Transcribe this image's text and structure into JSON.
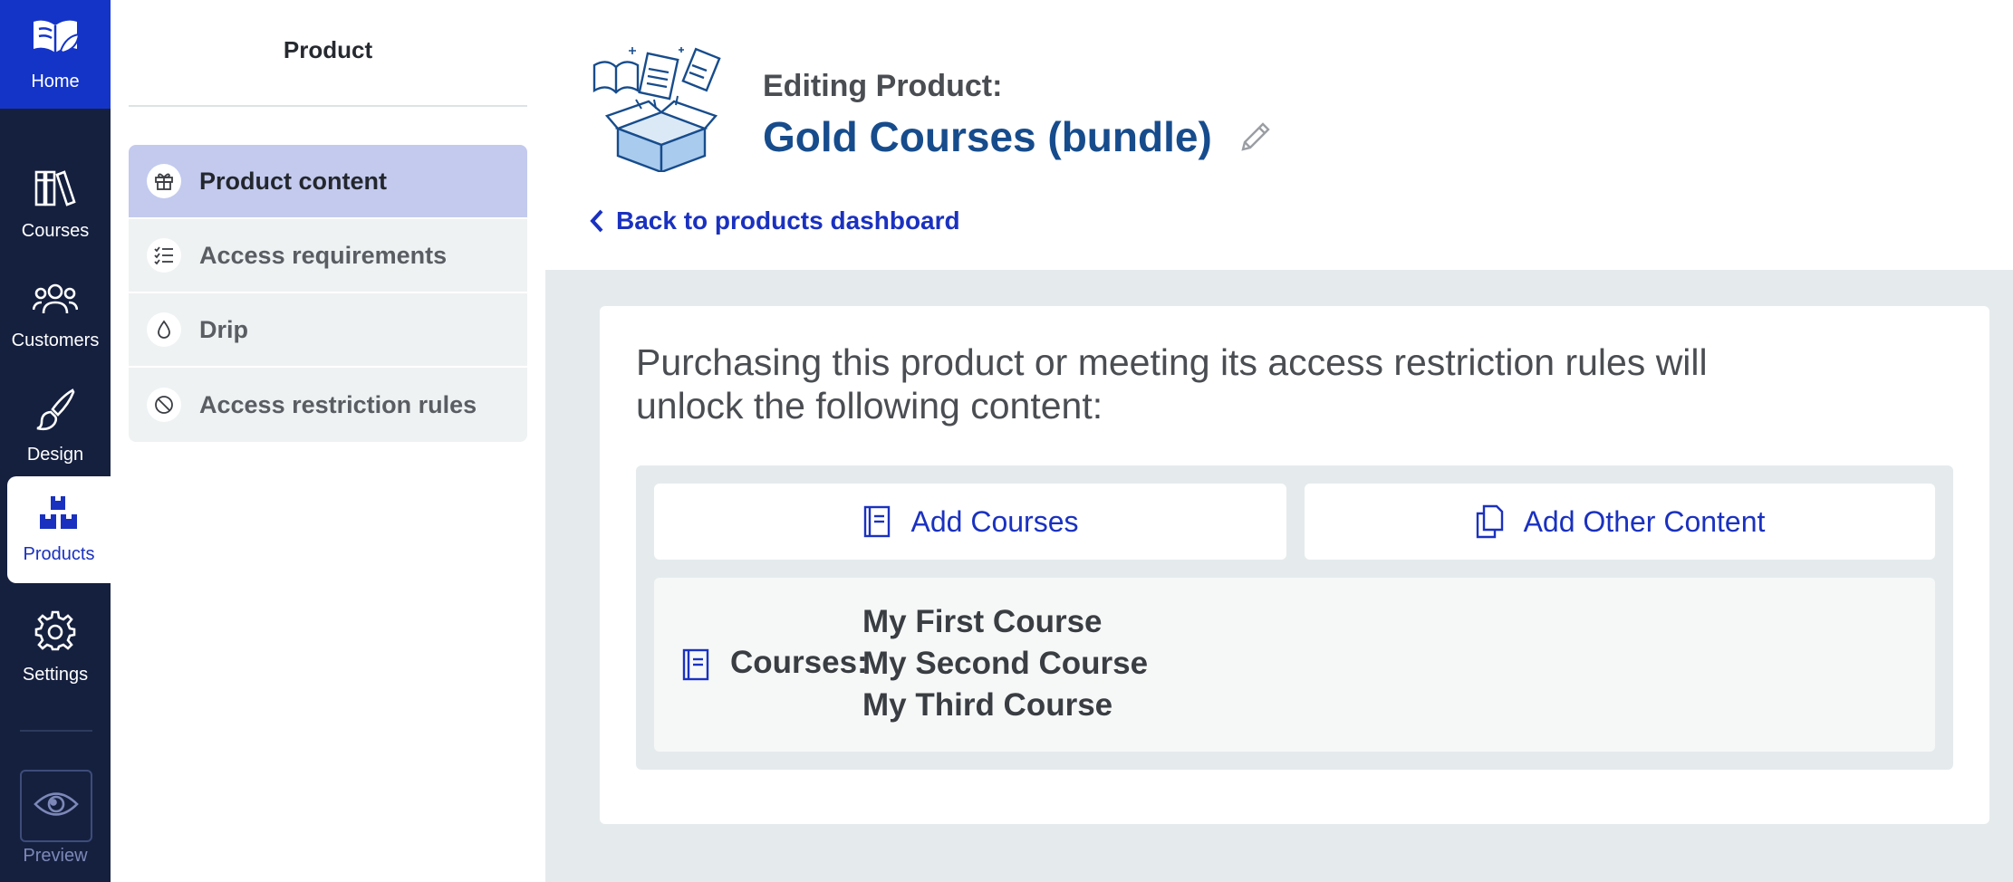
{
  "rail": {
    "home_label": "Home",
    "items": [
      {
        "label": "Courses",
        "icon": "library-books-icon"
      },
      {
        "label": "Customers",
        "icon": "users-icon"
      },
      {
        "label": "Design",
        "icon": "paintbrush-icon"
      },
      {
        "label": "Products",
        "icon": "boxes-icon",
        "active": true
      },
      {
        "label": "Settings",
        "icon": "gear-icon"
      }
    ],
    "preview_label": "Preview"
  },
  "submenu": {
    "title": "Product",
    "items": [
      {
        "label": "Product content",
        "icon": "gift-box-icon",
        "active": true
      },
      {
        "label": "Access requirements",
        "icon": "checklist-icon"
      },
      {
        "label": "Drip",
        "icon": "droplet-icon"
      },
      {
        "label": "Access restriction rules",
        "icon": "no-entry-icon"
      }
    ]
  },
  "header": {
    "editing_label": "Editing Product:",
    "product_name": "Gold Courses (bundle)",
    "back_link": "Back to products dashboard"
  },
  "content": {
    "description": "Purchasing this product or meeting its access restriction rules will unlock the following content:",
    "add_courses_label": "Add Courses",
    "add_other_label": "Add Other Content",
    "courses_label": "Courses:",
    "courses": [
      "My First Course",
      "My Second Course",
      "My Third Course"
    ]
  },
  "colors": {
    "accent": "#1a31c0",
    "rail_bg": "#15203f",
    "home_bg": "#1434c8",
    "active_menu": "#c3caee",
    "title_blue": "#174c8c",
    "panel_bg": "#e5ebec"
  }
}
